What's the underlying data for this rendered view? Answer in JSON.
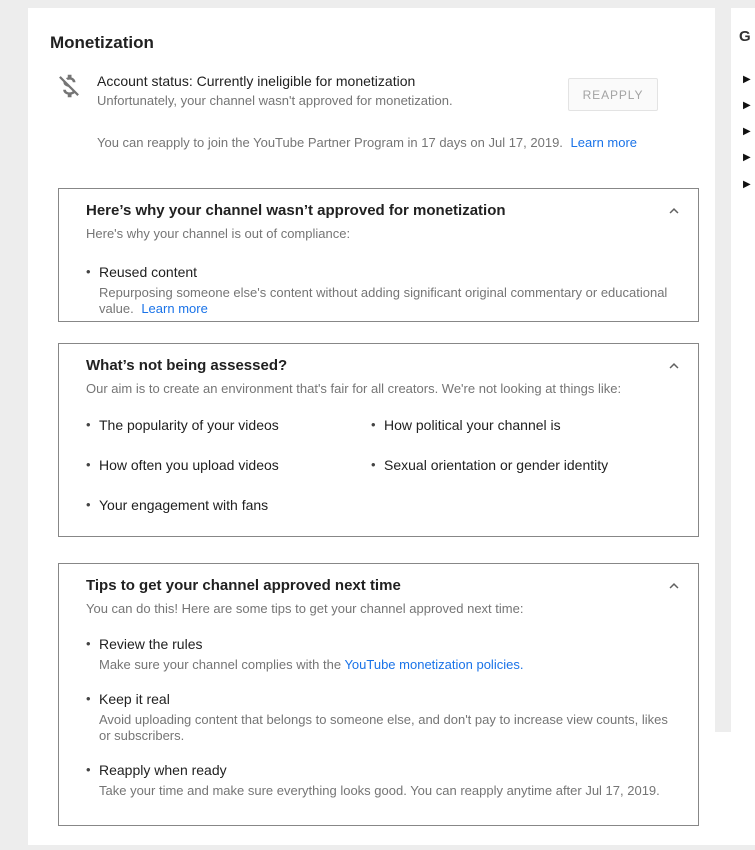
{
  "colors": {
    "page_bg": "#ededed",
    "link": "#1a73e8",
    "text_primary": "#212121",
    "text_secondary": "#757575",
    "box_border": "#878787",
    "button_text": "#a3a3a3"
  },
  "page": {
    "title": "Monetization"
  },
  "status": {
    "icon": "money-off",
    "title": "Account status: Currently ineligible for monetization",
    "subtitle": "Unfortunately, your channel wasn't approved for monetization.",
    "button_label": "REAPPLY",
    "note": "You can reapply to join the YouTube Partner Program in 17 days on Jul 17, 2019.",
    "note_link": "Learn more"
  },
  "cards": {
    "why_not_approved": {
      "title": "Here’s why your channel wasn’t approved for monetization",
      "subtitle": "Here's why your channel is out of compliance:",
      "reason_title": "Reused content",
      "reason_desc": "Repurposing someone else's content without adding significant original commentary or educational value.",
      "reason_link": "Learn more"
    },
    "not_assessed": {
      "title": "What’s not being assessed?",
      "subtitle": "Our aim is to create an environment that's fair for all creators. We're not looking at things like:",
      "items_left": [
        "The popularity of your videos",
        "How often you upload videos",
        "Your engagement with fans"
      ],
      "items_right": [
        "How political your channel is",
        "Sexual orientation or gender identity"
      ]
    },
    "tips": {
      "title": "Tips to get your channel approved next time",
      "subtitle": "You can do this! Here are some tips to get your channel approved next time:",
      "items": [
        {
          "title": "Review the rules",
          "desc_before": "Make sure your channel complies with the",
          "link": "YouTube monetization policies."
        },
        {
          "title": "Keep it real",
          "desc": "Avoid uploading content that belongs to someone else, and don't pay to increase view counts, likes or subscribers."
        },
        {
          "title": "Reapply when ready",
          "desc": "Take your time and make sure everything looks good. You can reapply anytime after Jul 17, 2019."
        }
      ]
    }
  },
  "side_panel": {
    "heading": "G",
    "marker": "▶"
  }
}
